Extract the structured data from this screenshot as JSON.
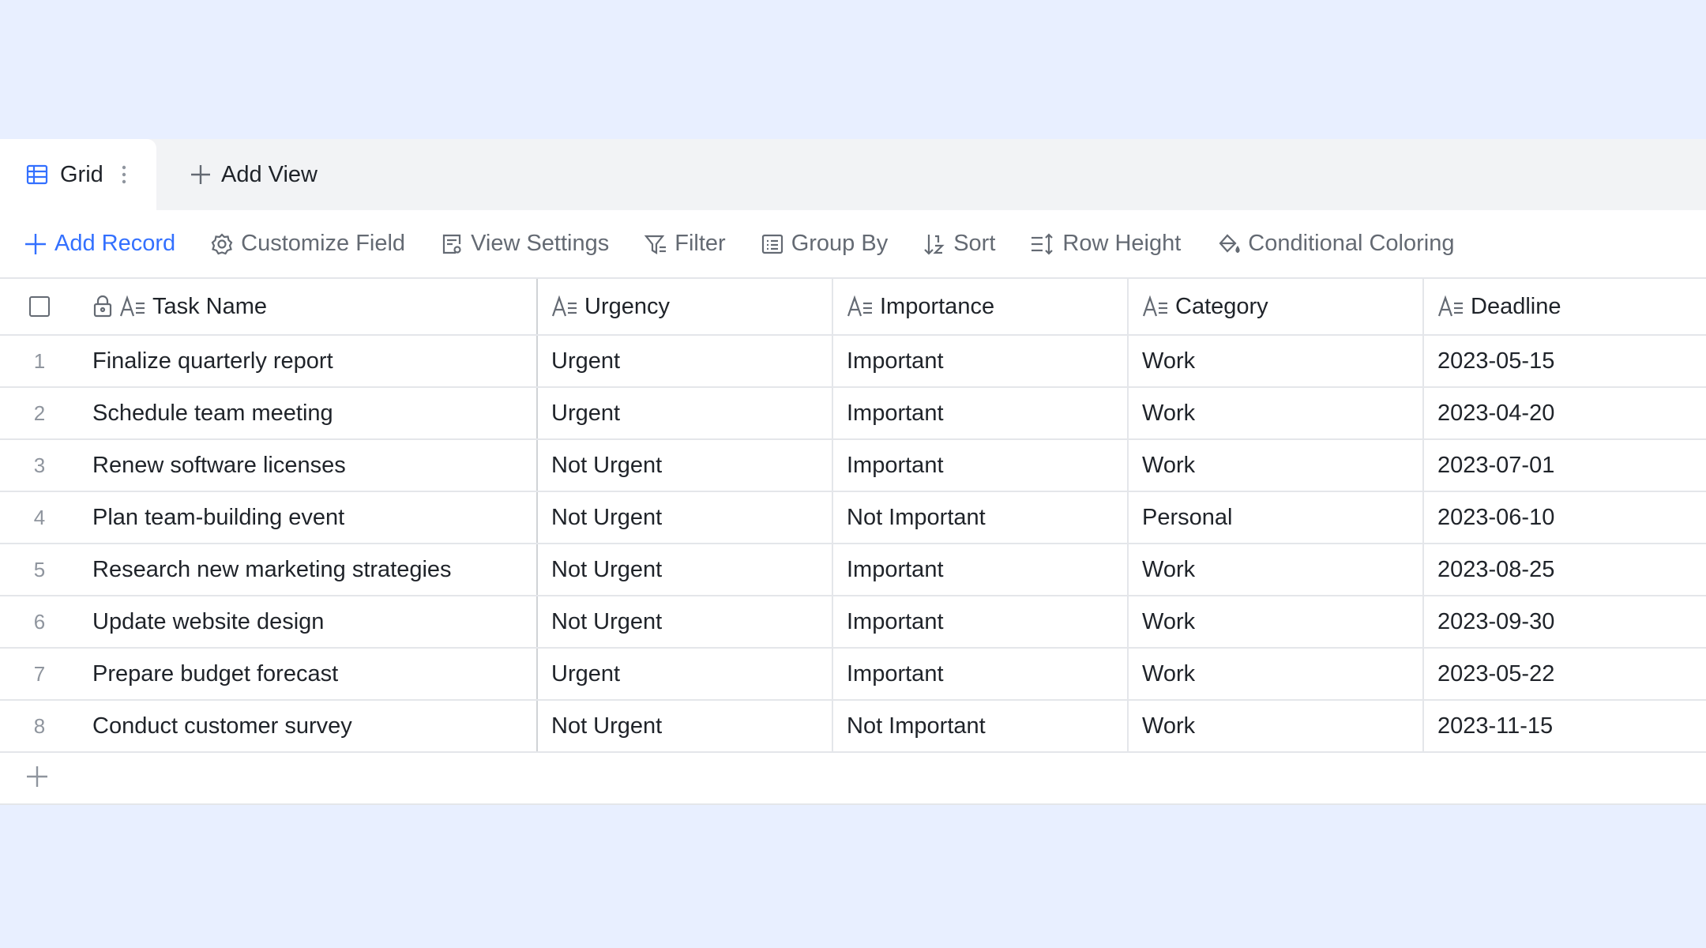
{
  "tabs": {
    "active_label": "Grid",
    "add_view_label": "Add View"
  },
  "toolbar": {
    "add_record": "Add Record",
    "customize_field": "Customize Field",
    "view_settings": "View Settings",
    "filter": "Filter",
    "group_by": "Group By",
    "sort": "Sort",
    "row_height": "Row Height",
    "conditional_coloring": "Conditional Coloring"
  },
  "columns": [
    "Task Name",
    "Urgency",
    "Importance",
    "Category",
    "Deadline"
  ],
  "rows": [
    {
      "num": "1",
      "task": "Finalize quarterly report",
      "urgency": "Urgent",
      "importance": "Important",
      "category": "Work",
      "deadline": "2023-05-15"
    },
    {
      "num": "2",
      "task": "Schedule team meeting",
      "urgency": "Urgent",
      "importance": "Important",
      "category": "Work",
      "deadline": "2023-04-20"
    },
    {
      "num": "3",
      "task": "Renew software licenses",
      "urgency": "Not Urgent",
      "importance": "Important",
      "category": "Work",
      "deadline": "2023-07-01"
    },
    {
      "num": "4",
      "task": "Plan team-building event",
      "urgency": "Not Urgent",
      "importance": "Not Important",
      "category": "Personal",
      "deadline": "2023-06-10"
    },
    {
      "num": "5",
      "task": "Research new marketing strategies",
      "urgency": "Not Urgent",
      "importance": "Important",
      "category": "Work",
      "deadline": "2023-08-25"
    },
    {
      "num": "6",
      "task": "Update website design",
      "urgency": "Not Urgent",
      "importance": "Important",
      "category": "Work",
      "deadline": "2023-09-30"
    },
    {
      "num": "7",
      "task": "Prepare budget forecast",
      "urgency": "Urgent",
      "importance": "Important",
      "category": "Work",
      "deadline": "2023-05-22"
    },
    {
      "num": "8",
      "task": "Conduct customer survey",
      "urgency": "Not Urgent",
      "importance": "Not Important",
      "category": "Work",
      "deadline": "2023-11-15"
    }
  ],
  "colors": {
    "background": "#e8efff",
    "accent": "#3370ff",
    "muted": "#646a73"
  }
}
